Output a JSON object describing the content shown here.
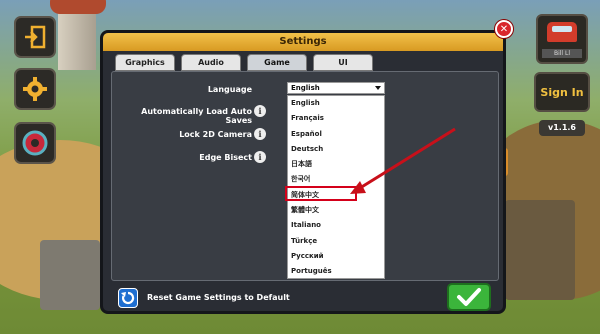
{
  "dialog": {
    "title": "Settings",
    "tabs": [
      {
        "label": "Graphics",
        "active": false
      },
      {
        "label": "Audio",
        "active": false
      },
      {
        "label": "Game",
        "active": true
      },
      {
        "label": "UI",
        "active": false
      }
    ],
    "settings": [
      {
        "label": "Language"
      },
      {
        "label": "Automatically Load Auto Saves",
        "info": "i"
      },
      {
        "label": "Lock 2D Camera",
        "info": "i"
      },
      {
        "label": "Edge Bisect",
        "info": "i"
      }
    ],
    "language_select": {
      "selected": "English",
      "options": [
        "English",
        "Français",
        "Español",
        "Deutsch",
        "日本語",
        "한국어",
        "简体中文",
        "繁體中文",
        "Italiano",
        "Türkçe",
        "Русский",
        "Português"
      ],
      "highlighted_option": "简体中文"
    },
    "reset_label": "Reset Game Settings to Default"
  },
  "hud": {
    "signin_label": "Sign In",
    "version": "v1.1.6",
    "garage_label": "Bill Ll"
  },
  "colors": {
    "title_bar": "#e7ad33",
    "highlight": "#d4001a",
    "ok_button": "#3bb53b",
    "reset_button": "#1f6fd1",
    "close_button": "#d9262c"
  },
  "icons": [
    "exit-door-icon",
    "gear-icon",
    "compass-icon",
    "close-icon",
    "reset-icon",
    "checkmark-icon",
    "info-icon",
    "dropdown-caret-icon",
    "red-arrow-annotation"
  ]
}
